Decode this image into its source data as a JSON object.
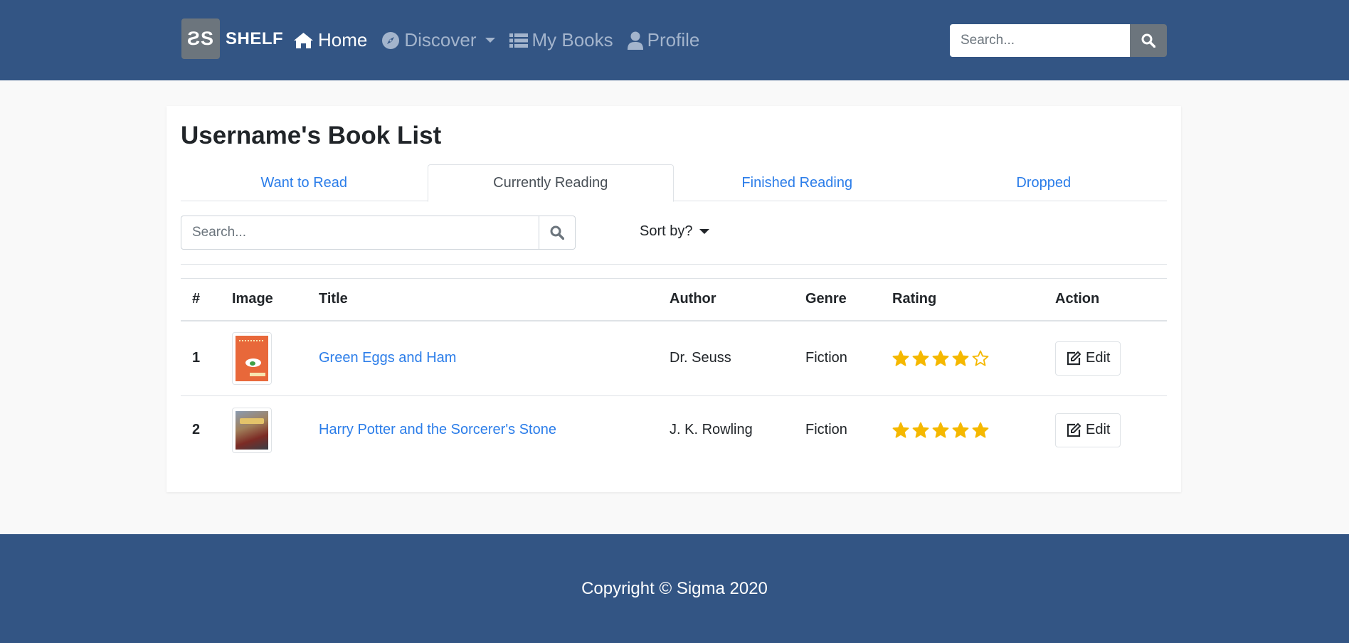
{
  "navbar": {
    "brand_logo": "ƧS",
    "brand_text": "SHELF",
    "items": [
      {
        "label": "Home",
        "icon": "home-icon",
        "active": true
      },
      {
        "label": "Discover",
        "icon": "compass-icon",
        "dropdown": true
      },
      {
        "label": "My Books",
        "icon": "list-icon"
      },
      {
        "label": "Profile",
        "icon": "user-icon"
      }
    ],
    "search_placeholder": "Search..."
  },
  "page": {
    "title": "Username's Book List",
    "tabs": [
      {
        "label": "Want to Read"
      },
      {
        "label": "Currently Reading",
        "active": true
      },
      {
        "label": "Finished Reading"
      },
      {
        "label": "Dropped"
      }
    ],
    "search_placeholder": "Search...",
    "sort_label": "Sort by?"
  },
  "table": {
    "headers": [
      "#",
      "Image",
      "Title",
      "Author",
      "Genre",
      "Rating",
      "Action"
    ],
    "rows": [
      {
        "num": "1",
        "title": "Green Eggs and Ham",
        "author": "Dr. Seuss",
        "genre": "Fiction",
        "rating": 4,
        "action": "Edit"
      },
      {
        "num": "2",
        "title": "Harry Potter and the Sorcerer's Stone",
        "author": "J. K. Rowling",
        "genre": "Fiction",
        "rating": 5,
        "action": "Edit"
      }
    ]
  },
  "footer": {
    "copyright": "Copyright © Sigma 2020"
  },
  "colors": {
    "primary": "#335584",
    "link": "#2b7de9",
    "star": "#f5b800"
  }
}
